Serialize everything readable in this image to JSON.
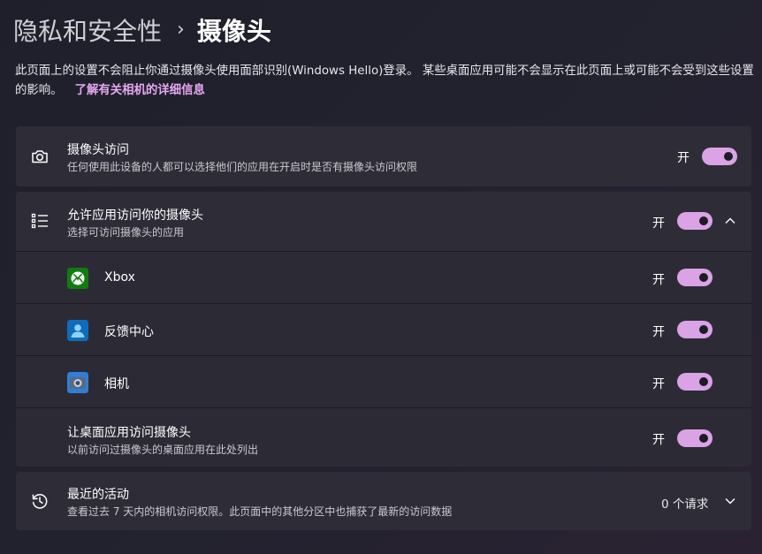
{
  "breadcrumb": {
    "parent": "隐私和安全性",
    "separator": "›",
    "current": "摄像头"
  },
  "description": {
    "text": "此页面上的设置不会阻止你通过摄像头使用面部识别(Windows Hello)登录。 某些桌面应用可能不会显示在此页面上或可能不会受到这些设置的影响。",
    "link": "了解有关相机的详细信息"
  },
  "camera_access": {
    "icon": "camera-icon",
    "title": "摄像头访问",
    "subtitle": "任何使用此设备的人都可以选择他们的应用在开启时是否有摄像头访问权限",
    "state_label": "开",
    "on": true
  },
  "app_access": {
    "icon": "list-icon",
    "title": "允许应用访问你的摄像头",
    "subtitle": "选择可访问摄像头的应用",
    "state_label": "开",
    "on": true,
    "expanded": true,
    "apps": [
      {
        "name": "Xbox",
        "icon": "xbox-icon",
        "state_label": "开",
        "on": true
      },
      {
        "name": "反馈中心",
        "icon": "feedback-hub-icon",
        "state_label": "开",
        "on": true
      },
      {
        "name": "相机",
        "icon": "camera-app-icon",
        "state_label": "开",
        "on": true
      }
    ],
    "desktop": {
      "title": "让桌面应用访问摄像头",
      "subtitle": "以前访问过摄像头的桌面应用在此处列出",
      "state_label": "开",
      "on": true
    }
  },
  "recent_activity": {
    "icon": "history-icon",
    "title": "最近的活动",
    "subtitle": "查看过去 7 天内的相机访问权限。此页面中的其他分区中也捕获了最新的访问数据",
    "count": "0 个请求"
  },
  "colors": {
    "accent": "#d9a3e6",
    "link": "#e7a8f0",
    "card": "#2e2d37",
    "xbox_green": "#107c10",
    "feedback_blue": "#0f6cbd"
  }
}
